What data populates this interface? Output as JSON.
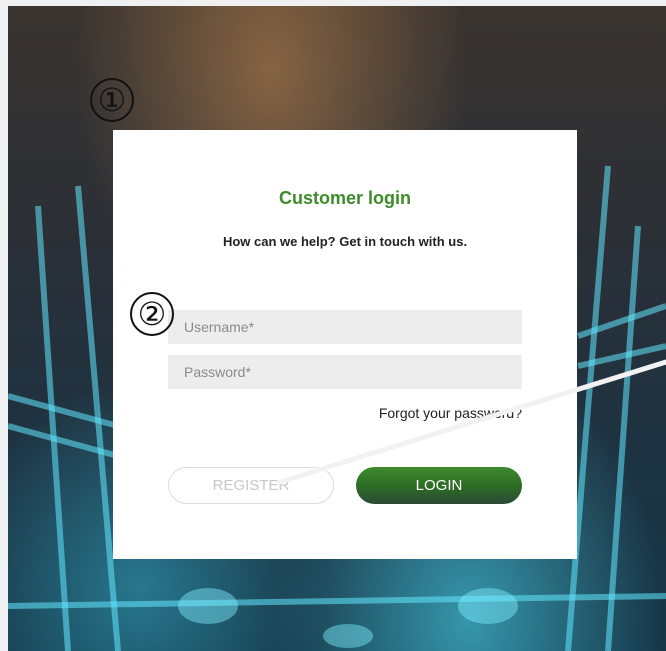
{
  "markers": {
    "one": "①",
    "two": "②"
  },
  "login": {
    "title": "Customer login",
    "subtitle": "How can we help? Get in touch with us.",
    "username_placeholder": "Username*",
    "password_placeholder": "Password*",
    "forgot_label": "Forgot your password?",
    "register_label": "REGISTER",
    "login_label": "LOGIN"
  },
  "colors": {
    "title_green": "#3d8b2a",
    "login_button_top": "#3f8a2d",
    "login_button_bottom": "#2b4a35",
    "field_background": "#ededed"
  }
}
